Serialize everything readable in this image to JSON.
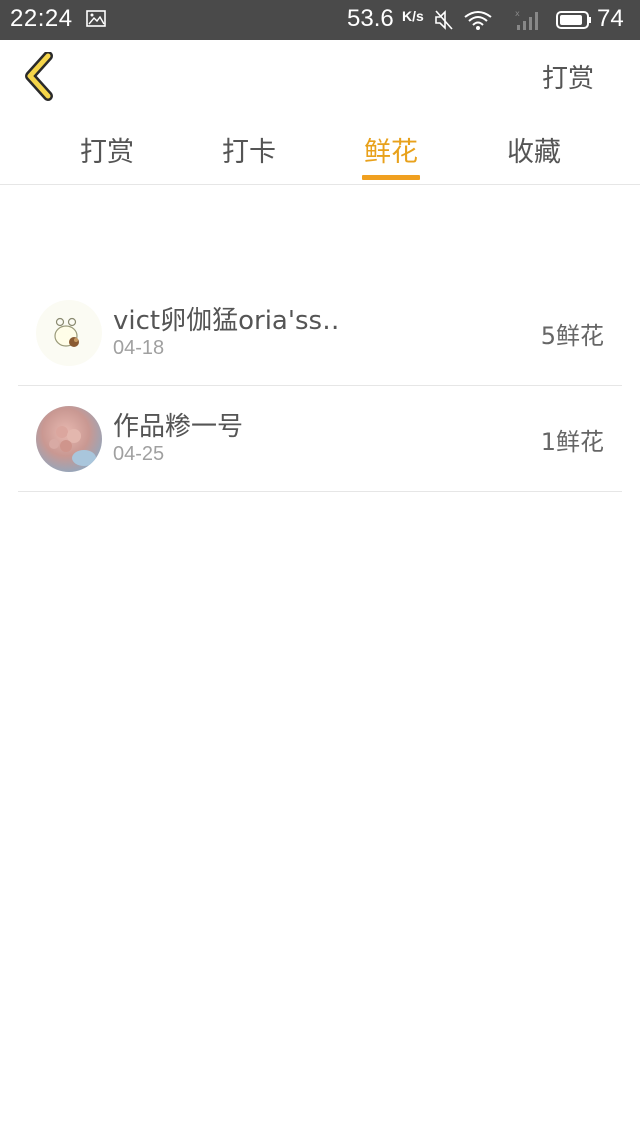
{
  "status_bar": {
    "time": "22:24",
    "speed": "53.6",
    "speed_unit": "K/s",
    "battery": "74"
  },
  "header": {
    "back_icon": "chevron-left-icon",
    "reward_label": "打赏"
  },
  "tabs": [
    {
      "label": "打赏",
      "active": false
    },
    {
      "label": "打卡",
      "active": false
    },
    {
      "label": "鲜花",
      "active": true
    },
    {
      "label": "收藏",
      "active": false
    }
  ],
  "colors": {
    "accent": "#e8a11b",
    "status_bar_bg": "#4a4a4a",
    "back_icon_fill": "#f5d54a"
  },
  "items": [
    {
      "name": "vict卵伽猛oria'ss‥",
      "date": "04-18",
      "count": "5鲜花"
    },
    {
      "name": "作品糁一号",
      "date": "04-25",
      "count": "1鲜花"
    }
  ]
}
